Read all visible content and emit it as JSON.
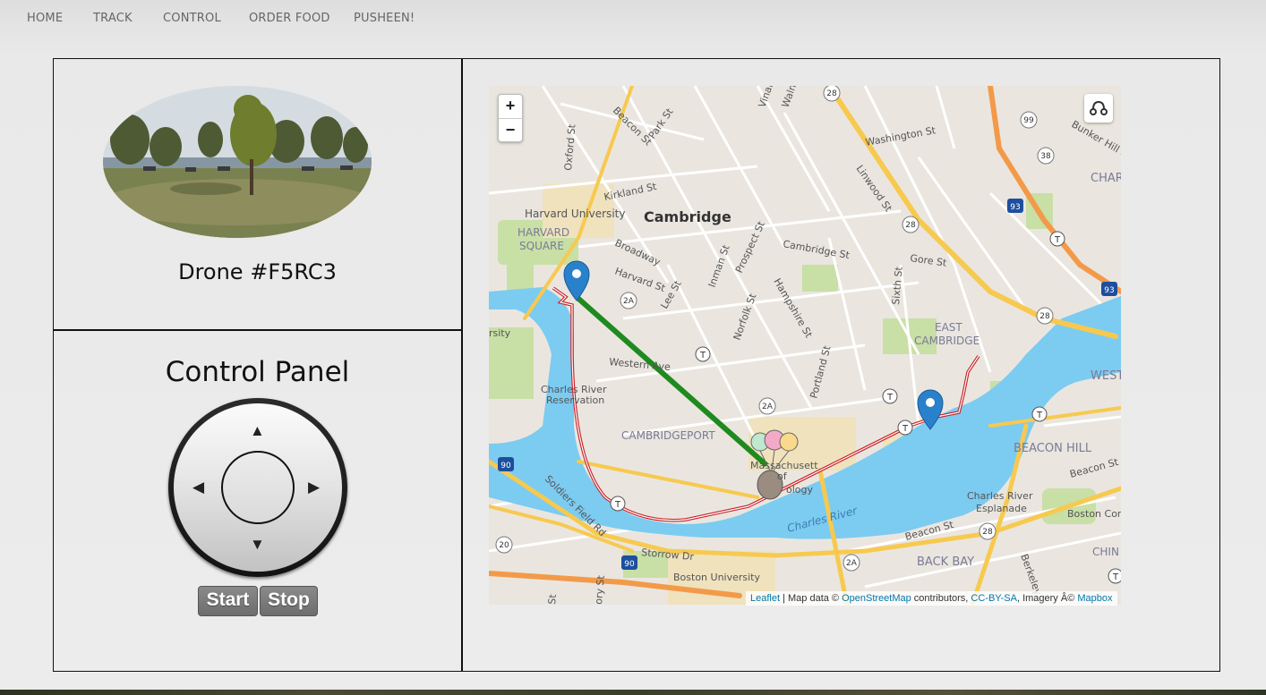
{
  "nav": {
    "items": [
      "HOME",
      "TRACK",
      "CONTROL",
      "ORDER FOOD",
      "PUSHEEN!"
    ]
  },
  "drone": {
    "title": "Drone #F5RC3"
  },
  "control_panel": {
    "title": "Control Panel",
    "arrows": {
      "up": "▲",
      "down": "▼",
      "left": "◀",
      "right": "▶"
    },
    "start_label": "Start",
    "stop_label": "Stop"
  },
  "map": {
    "zoom_in": "+",
    "zoom_out": "−",
    "labels": {
      "cambridge": "Cambridge",
      "harvard_university": "Harvard University",
      "harvard_square_1": "HARVARD",
      "harvard_square_2": "SQUARE",
      "cambridgeport": "CAMBRIDGEPORT",
      "east_cambridge_1": "EAST",
      "east_cambridge_2": "CAMBRIDGE",
      "beacon_hill": "BEACON HILL",
      "back_bay": "BACK BAY",
      "west": "WEST",
      "char": "CHAR",
      "chin": "CHIN",
      "charles_river": "Charles River",
      "charles_river_reservation_1": "Charles River",
      "charles_river_reservation_2": "Reservation",
      "charles_river_esplanade_1": "Charles River",
      "charles_river_esplanade_2": "Esplanade",
      "boston_university": "Boston University",
      "boston_common": "Boston Comm",
      "mit_1": "Massachusett",
      "mit_2": "ology",
      "mit_3": "of",
      "rsity": "rsity",
      "washington_st": "Washington St",
      "bunker_hill_st": "Bunker Hill St",
      "kirkland_st": "Kirkland St",
      "beacon_st_top": "Beacon St",
      "park_st": "Park St",
      "oxford_st": "Oxford St",
      "linwood_st": "Linwood St",
      "broadway": "Broadway",
      "harvard_st": "Harvard St",
      "lee_st": "Lee St",
      "inman_st": "Inman St",
      "prospect_st": "Prospect St",
      "cambridge_st": "Cambridge St",
      "gore_st": "Gore St",
      "sixth_st": "Sixth St",
      "hampshire_st": "Hampshire St",
      "norfolk_st": "Norfolk St",
      "western_ave": "Western Ave",
      "portland_st": "Portland St",
      "soldiers_field_rd": "Soldiers Field Rd",
      "storrow_dr": "Storrow Dr",
      "beacon_st_bottom": "Beacon St",
      "beacon_st_right": "Beacon St",
      "berkeley": "Berkeley",
      "vinal": "Vinal",
      "waln": "Waln",
      "ory_st": "ory St",
      "st": "St"
    },
    "shields": {
      "r28a": "28",
      "r28b": "28",
      "r28c": "28",
      "r28d": "28",
      "r99": "99",
      "r38": "38",
      "r2a_a": "2A",
      "r2a_b": "2A",
      "r2a_c": "2A",
      "r20": "20",
      "i90a": "90",
      "i90b": "90",
      "i93a": "93",
      "i93b": "93"
    },
    "transit": "T",
    "attribution": {
      "leaflet": "Leaflet",
      "sep": " | Map data © ",
      "osm": "OpenStreetMap",
      "contrib": " contributors, ",
      "cc": "CC-BY-SA",
      "imagery": ", Imagery Â© ",
      "mapbox": "Mapbox"
    }
  }
}
